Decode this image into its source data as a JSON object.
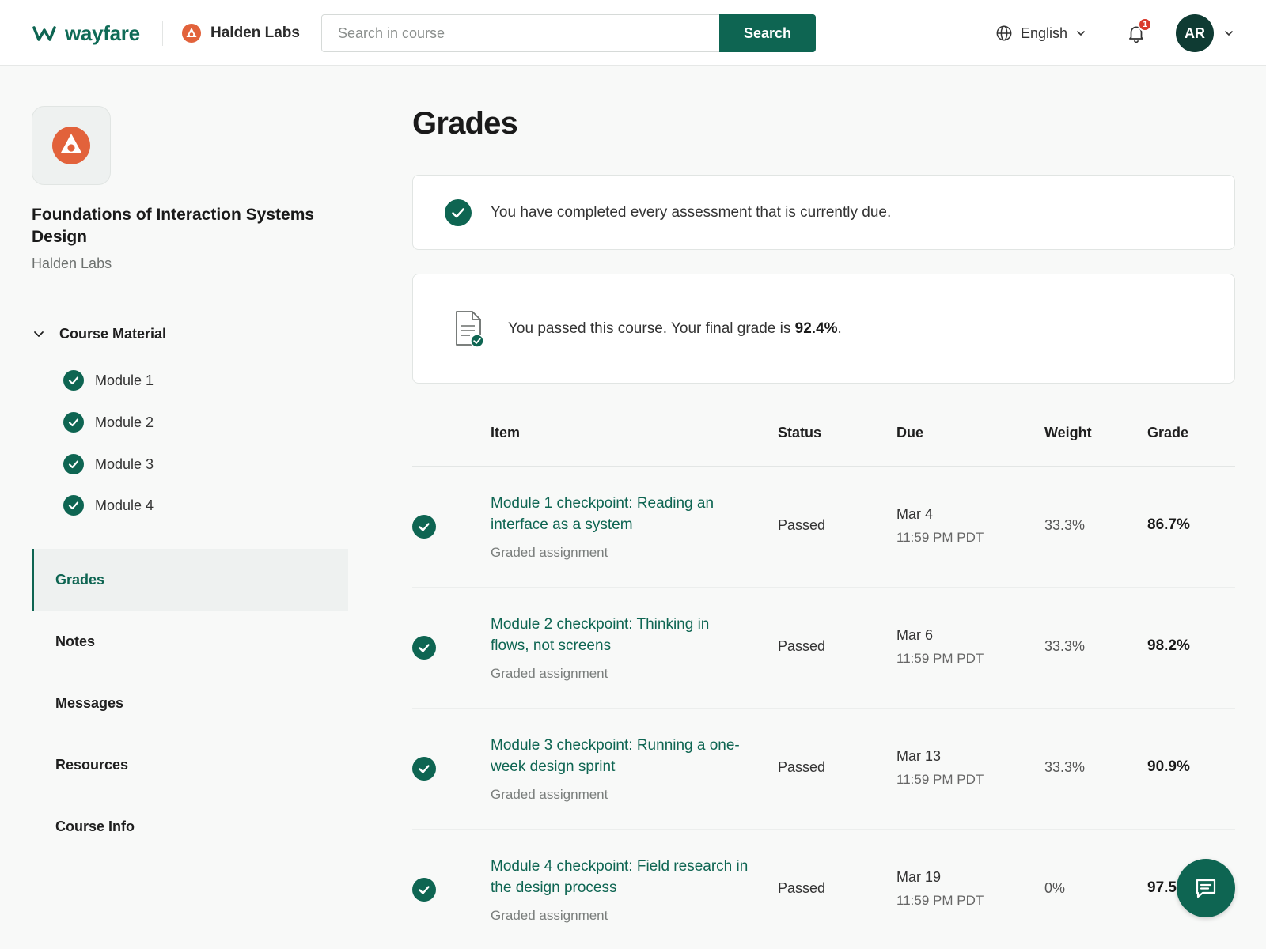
{
  "header": {
    "brand": "wayfare",
    "partner": "Halden Labs",
    "search": {
      "placeholder": "Search in course",
      "button": "Search"
    },
    "language": "English",
    "notifications": {
      "count": "1"
    },
    "user_initials": "AR"
  },
  "sidebar": {
    "course_title": "Foundations of Interaction Systems Design",
    "provider": "Halden Labs",
    "material_label": "Course Material",
    "modules": [
      "Module 1",
      "Module 2",
      "Module 3",
      "Module 4"
    ],
    "nav": [
      "Grades",
      "Notes",
      "Messages",
      "Resources",
      "Course Info"
    ],
    "active_nav": "Grades"
  },
  "main": {
    "title": "Grades",
    "completed_message": "You have completed every assessment that is currently due.",
    "passed_prefix": "You passed this course. Your final grade is ",
    "final_grade": "92.4%",
    "passed_suffix": "."
  },
  "table": {
    "headers": {
      "item": "Item",
      "status": "Status",
      "due": "Due",
      "weight": "Weight",
      "grade": "Grade"
    },
    "rows": [
      {
        "title": "Module 1 checkpoint: Reading an interface as a system",
        "type": "Graded assignment",
        "status": "Passed",
        "due_date": "Mar 4",
        "due_time": "11:59 PM PDT",
        "weight": "33.3%",
        "grade": "86.7%"
      },
      {
        "title": "Module 2 checkpoint: Thinking in flows, not screens",
        "type": "Graded assignment",
        "status": "Passed",
        "due_date": "Mar 6",
        "due_time": "11:59 PM PDT",
        "weight": "33.3%",
        "grade": "98.2%"
      },
      {
        "title": "Module 3 checkpoint: Running a one-week design sprint",
        "type": "Graded assignment",
        "status": "Passed",
        "due_date": "Mar 13",
        "due_time": "11:59 PM PDT",
        "weight": "33.3%",
        "grade": "90.9%"
      },
      {
        "title": "Module 4 checkpoint: Field research in the design process",
        "type": "Graded assignment",
        "status": "Passed",
        "due_date": "Mar 19",
        "due_time": "11:59 PM PDT",
        "weight": "0%",
        "grade": "97.5%"
      }
    ]
  },
  "colors": {
    "brand": "#0e6552",
    "accent_orange": "#e2623b",
    "badge_red": "#d9392b"
  }
}
